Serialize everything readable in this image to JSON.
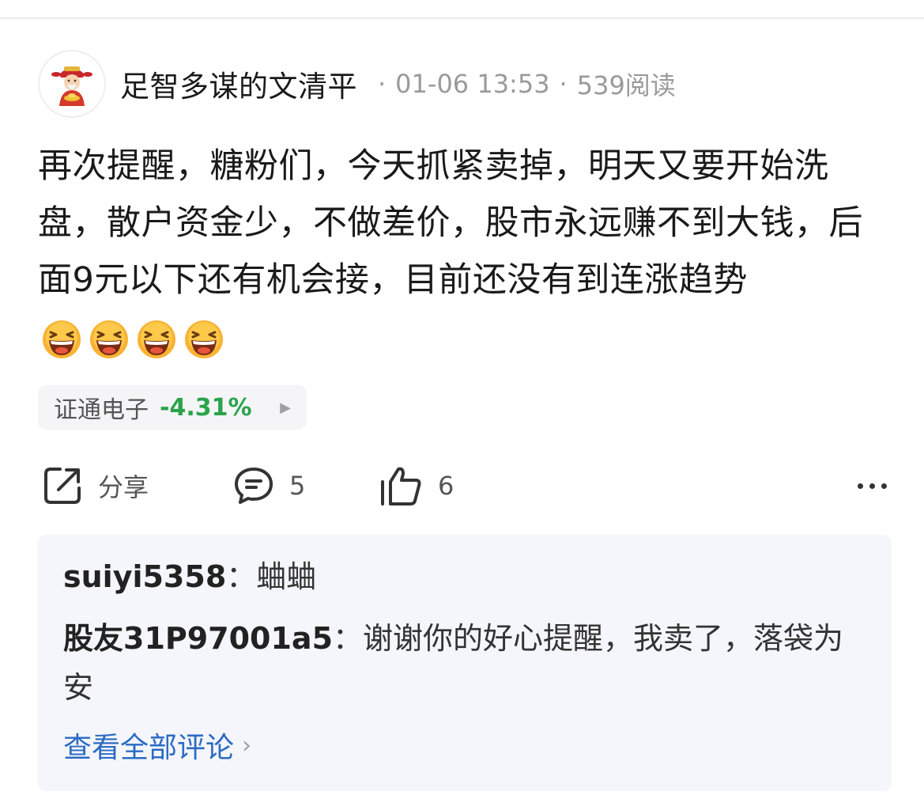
{
  "post": {
    "author": "足智多谋的文清平",
    "sep": "·",
    "date": "01-06 13:53",
    "reads": "539阅读",
    "content": "再次提醒，糖粉们，今天抓紧卖掉，明天又要开始洗盘，散户资金少，不做差价，股市永远赚不到大钱，后面9元以下还有机会接，目前还没有到连涨趋势",
    "emojis": [
      "laughing-face",
      "laughing-face",
      "laughing-face",
      "laughing-face"
    ]
  },
  "stock": {
    "name": "证通电子",
    "change": "-4.31%",
    "change_color": "#2aa34a"
  },
  "actions": {
    "share_label": "分享",
    "comment_count": "5",
    "like_count": "6"
  },
  "comments": [
    {
      "user": "suiyi5358",
      "sep": "：",
      "text": "蛐蛐"
    },
    {
      "user": "股友31P97001a5",
      "sep": "：",
      "text": "谢谢你的好心提醒，我卖了，落袋为安"
    }
  ],
  "view_all": "查看全部评论",
  "colors": {
    "accent_link": "#2b6bc4",
    "comment_bg": "#f5f6fb",
    "chip_bg": "#f5f5f7"
  }
}
